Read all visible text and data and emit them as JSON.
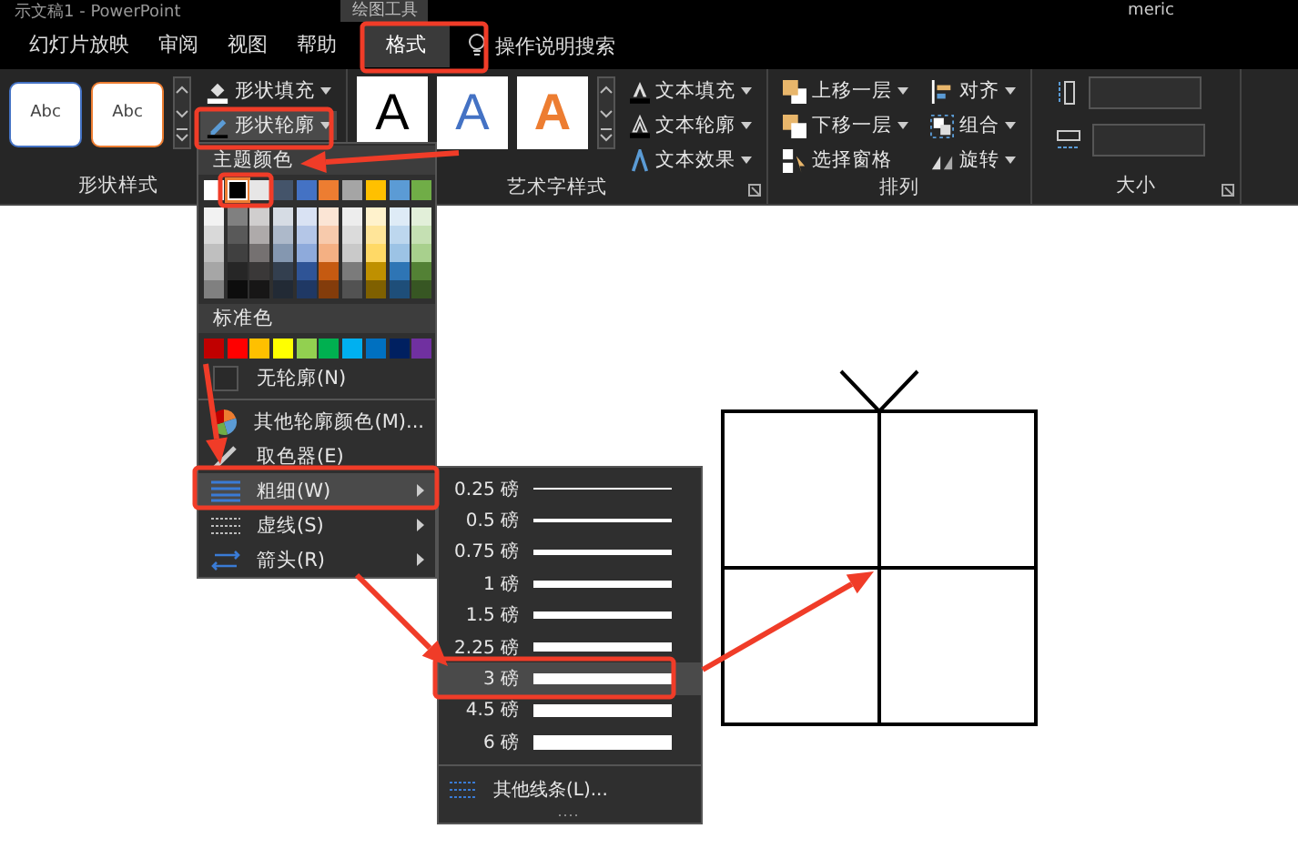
{
  "title_bar": {
    "title": "示文稿1 - PowerPoint",
    "context_tab": "绘图工具",
    "user": "meric"
  },
  "tabs": [
    {
      "label": "幻灯片放映",
      "selected": false
    },
    {
      "label": "审阅",
      "selected": false
    },
    {
      "label": "视图",
      "selected": false
    },
    {
      "label": "帮助",
      "selected": false
    },
    {
      "label": "格式",
      "selected": true
    }
  ],
  "search": {
    "label": "操作说明搜索"
  },
  "ribbon": {
    "groups": [
      {
        "kind": "shape-styles",
        "label": "形状样式",
        "launcher": false,
        "styles": [
          {
            "text": "Abc",
            "color": "#4472c4"
          },
          {
            "text": "Abc",
            "color": "#ed7d31"
          }
        ],
        "commands": [
          {
            "kind": "fill",
            "label": "形状填充",
            "caret": true,
            "pressed": false
          },
          {
            "kind": "outline",
            "label": "形状轮廓",
            "caret": true,
            "pressed": true
          }
        ]
      },
      {
        "kind": "wordart",
        "label": "艺术字样式",
        "launcher": true,
        "styles": [
          {
            "text": "A",
            "kind": "solid",
            "color": "#000000"
          },
          {
            "text": "A",
            "kind": "solid",
            "color": "#4472c4"
          },
          {
            "text": "A",
            "kind": "outline",
            "color": "#ed7d31"
          }
        ],
        "commands": [
          {
            "kind": "text-fill",
            "label": "文本填充",
            "caret": true,
            "pressed": false
          },
          {
            "kind": "text-outline",
            "label": "文本轮廓",
            "caret": true,
            "pressed": false
          },
          {
            "kind": "text-effect",
            "label": "文本效果",
            "caret": true,
            "pressed": false
          }
        ]
      },
      {
        "kind": "arrange",
        "label": "排列",
        "launcher": false,
        "commands": [
          {
            "kind": "forward",
            "label": "上移一层",
            "caret": true,
            "pressed": false
          },
          {
            "kind": "backward",
            "label": "下移一层",
            "caret": true,
            "pressed": false
          },
          {
            "kind": "pane",
            "label": "选择窗格",
            "caret": false,
            "pressed": false
          },
          {
            "kind": "align",
            "label": "对齐",
            "caret": true,
            "pressed": false
          },
          {
            "kind": "group",
            "label": "组合",
            "caret": true,
            "pressed": false
          },
          {
            "kind": "rotate",
            "label": "旋转",
            "caret": true,
            "pressed": false
          }
        ]
      },
      {
        "kind": "size",
        "label": "大小",
        "launcher": true,
        "fields": [
          {
            "kind": "height"
          },
          {
            "kind": "width"
          }
        ]
      }
    ]
  },
  "outline_menu": {
    "theme_header": "主题颜色",
    "theme_colors": [
      {
        "color": "#ffffff",
        "selected": false,
        "shades": [
          {
            "color": "#f2f2f2"
          },
          {
            "color": "#d9d9d9"
          },
          {
            "color": "#bfbfbf"
          },
          {
            "color": "#a6a6a6"
          },
          {
            "color": "#808080"
          }
        ]
      },
      {
        "color": "#000000",
        "selected": true,
        "shades": [
          {
            "color": "#808080"
          },
          {
            "color": "#595959"
          },
          {
            "color": "#404040"
          },
          {
            "color": "#262626"
          },
          {
            "color": "#0d0d0d"
          }
        ]
      },
      {
        "color": "#e7e6e6",
        "selected": false,
        "shades": [
          {
            "color": "#d0cece"
          },
          {
            "color": "#aeaaaa"
          },
          {
            "color": "#757171"
          },
          {
            "color": "#3a3838"
          },
          {
            "color": "#171616"
          }
        ]
      },
      {
        "color": "#44546a",
        "selected": false,
        "shades": [
          {
            "color": "#d6dce4"
          },
          {
            "color": "#adb9ca"
          },
          {
            "color": "#8497b0"
          },
          {
            "color": "#333f4f"
          },
          {
            "color": "#222a35"
          }
        ]
      },
      {
        "color": "#4472c4",
        "selected": false,
        "shades": [
          {
            "color": "#d9e2f3"
          },
          {
            "color": "#b4c6e7"
          },
          {
            "color": "#8eaadb"
          },
          {
            "color": "#2f5496"
          },
          {
            "color": "#1f3864"
          }
        ]
      },
      {
        "color": "#ed7d31",
        "selected": false,
        "shades": [
          {
            "color": "#fbe5d5"
          },
          {
            "color": "#f7caac"
          },
          {
            "color": "#f4b083"
          },
          {
            "color": "#c55a11"
          },
          {
            "color": "#833c0b"
          }
        ]
      },
      {
        "color": "#a5a5a5",
        "selected": false,
        "shades": [
          {
            "color": "#ededed"
          },
          {
            "color": "#dbdbdb"
          },
          {
            "color": "#c9c9c9"
          },
          {
            "color": "#7b7b7b"
          },
          {
            "color": "#525252"
          }
        ]
      },
      {
        "color": "#ffc000",
        "selected": false,
        "shades": [
          {
            "color": "#fff2cc"
          },
          {
            "color": "#ffe599"
          },
          {
            "color": "#ffd966"
          },
          {
            "color": "#bf9000"
          },
          {
            "color": "#7f6000"
          }
        ]
      },
      {
        "color": "#5b9bd5",
        "selected": false,
        "shades": [
          {
            "color": "#deebf6"
          },
          {
            "color": "#bdd7ee"
          },
          {
            "color": "#9cc3e5"
          },
          {
            "color": "#2e75b5"
          },
          {
            "color": "#1e4e79"
          }
        ]
      },
      {
        "color": "#70ad47",
        "selected": false,
        "shades": [
          {
            "color": "#e2efd9"
          },
          {
            "color": "#c5e0b3"
          },
          {
            "color": "#a8d08d"
          },
          {
            "color": "#538135"
          },
          {
            "color": "#375623"
          }
        ]
      }
    ],
    "standard_header": "标准色",
    "standard_colors": [
      {
        "color": "#c00000"
      },
      {
        "color": "#ff0000"
      },
      {
        "color": "#ffc000"
      },
      {
        "color": "#ffff00"
      },
      {
        "color": "#92d050"
      },
      {
        "color": "#00b050"
      },
      {
        "color": "#00b0f0"
      },
      {
        "color": "#0070c0"
      },
      {
        "color": "#002060"
      },
      {
        "color": "#7030a0"
      }
    ],
    "items": [
      {
        "kind": "no-outline",
        "label": "无轮廓(N)",
        "highlighted": false,
        "submenu": false
      },
      {
        "kind": "more-colors",
        "label": "其他轮廓颜色(M)...",
        "highlighted": false,
        "submenu": false
      },
      {
        "kind": "eyedropper",
        "label": "取色器(E)",
        "highlighted": false,
        "submenu": false
      },
      {
        "kind": "weight",
        "label": "粗细(W)",
        "highlighted": true,
        "submenu": true
      },
      {
        "kind": "dashes",
        "label": "虚线(S)",
        "highlighted": false,
        "submenu": true
      },
      {
        "kind": "arrows",
        "label": "箭头(R)",
        "highlighted": false,
        "submenu": true
      }
    ]
  },
  "weight_menu": {
    "items": [
      {
        "label": "0.25 磅",
        "selected": false
      },
      {
        "label": "0.5 磅",
        "selected": false
      },
      {
        "label": "0.75 磅",
        "selected": false
      },
      {
        "label": "1 磅",
        "selected": false
      },
      {
        "label": "1.5 磅",
        "selected": false
      },
      {
        "label": "2.25 磅",
        "selected": false
      },
      {
        "label": "3 磅",
        "selected": true
      },
      {
        "label": "4.5 磅",
        "selected": false
      },
      {
        "label": "6 磅",
        "selected": false
      }
    ],
    "more": {
      "label": "其他线条(L)..."
    }
  }
}
